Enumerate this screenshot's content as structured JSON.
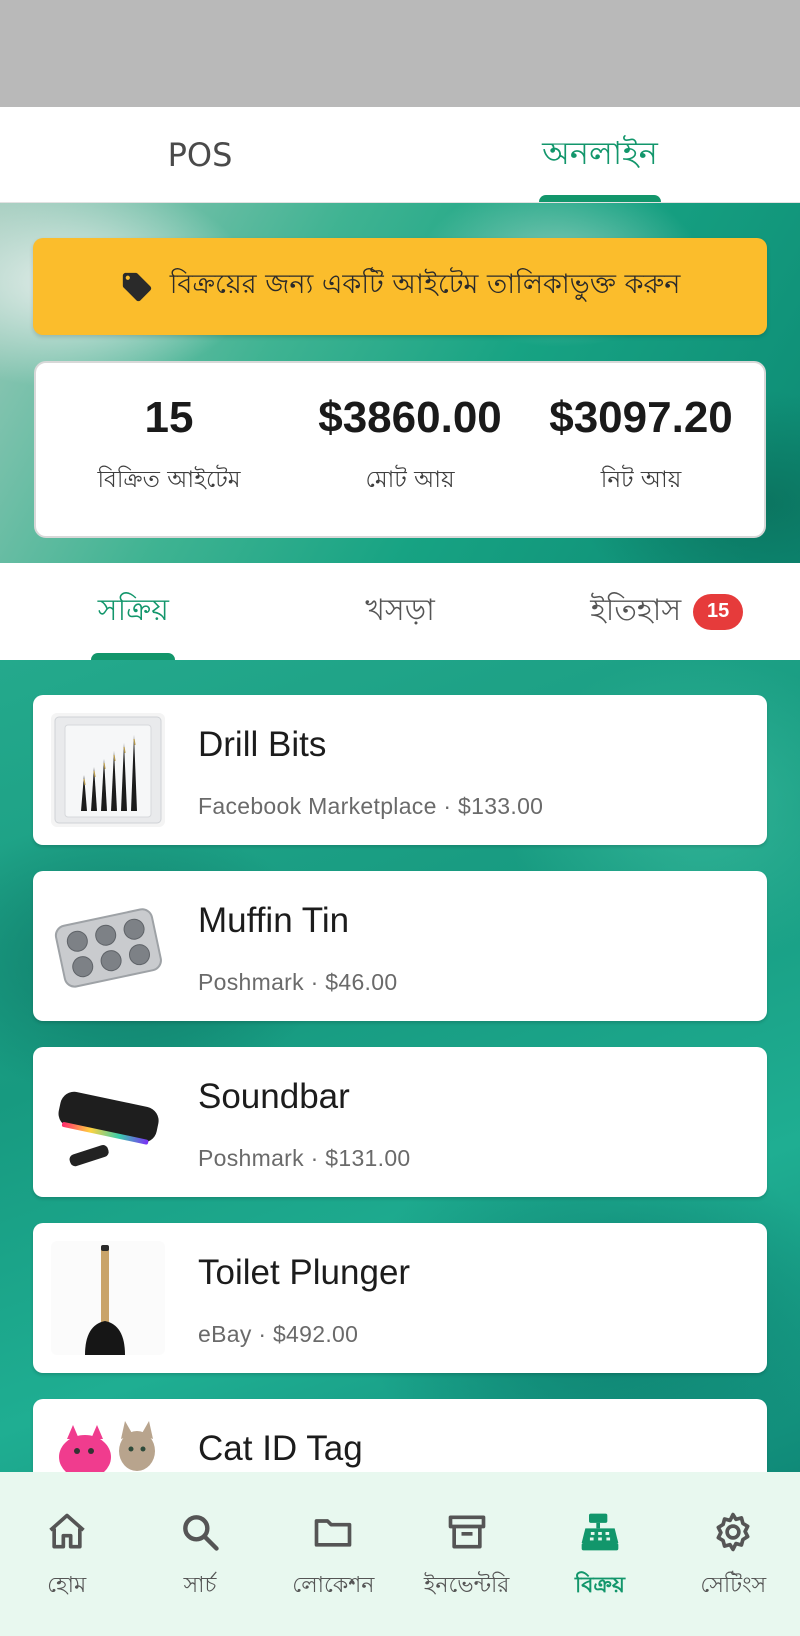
{
  "top_tabs": [
    {
      "label": "POS"
    },
    {
      "label": "অনলাইন"
    }
  ],
  "promo": {
    "label": "বিক্রয়ের জন্য একটি আইটেম তালিকাভুক্ত করুন",
    "icon": "tag-icon"
  },
  "stats": [
    {
      "value": "15",
      "label": "বিক্রিত আইটেম"
    },
    {
      "value": "$3860.00",
      "label": "মোট আয়"
    },
    {
      "value": "$3097.20",
      "label": "নিট আয়"
    }
  ],
  "sub_tabs": [
    {
      "label": "সক্রিয়"
    },
    {
      "label": "খসড়া"
    },
    {
      "label": "ইতিহাস",
      "badge": "15"
    }
  ],
  "items": [
    {
      "title": "Drill Bits",
      "subtitle": "Facebook Marketplace · $133.00"
    },
    {
      "title": "Muffin Tin",
      "subtitle": "Poshmark · $46.00"
    },
    {
      "title": "Soundbar",
      "subtitle": "Poshmark · $131.00"
    },
    {
      "title": "Toilet Plunger",
      "subtitle": "eBay · $492.00"
    },
    {
      "title": "Cat ID Tag",
      "subtitle": ""
    }
  ],
  "nav": [
    {
      "label": "হোম",
      "icon": "home-icon"
    },
    {
      "label": "সার্চ",
      "icon": "search-icon"
    },
    {
      "label": "লোকেশন",
      "icon": "folder-icon"
    },
    {
      "label": "ইনভেন্টরি",
      "icon": "archive-icon"
    },
    {
      "label": "বিক্রয়",
      "icon": "register-icon"
    },
    {
      "label": "সেটিংস",
      "icon": "gear-icon"
    }
  ],
  "colors": {
    "accent": "#12966b",
    "promo": "#fbbd2c",
    "badge": "#e63b3b",
    "nav_bg": "#e8f8ef"
  }
}
